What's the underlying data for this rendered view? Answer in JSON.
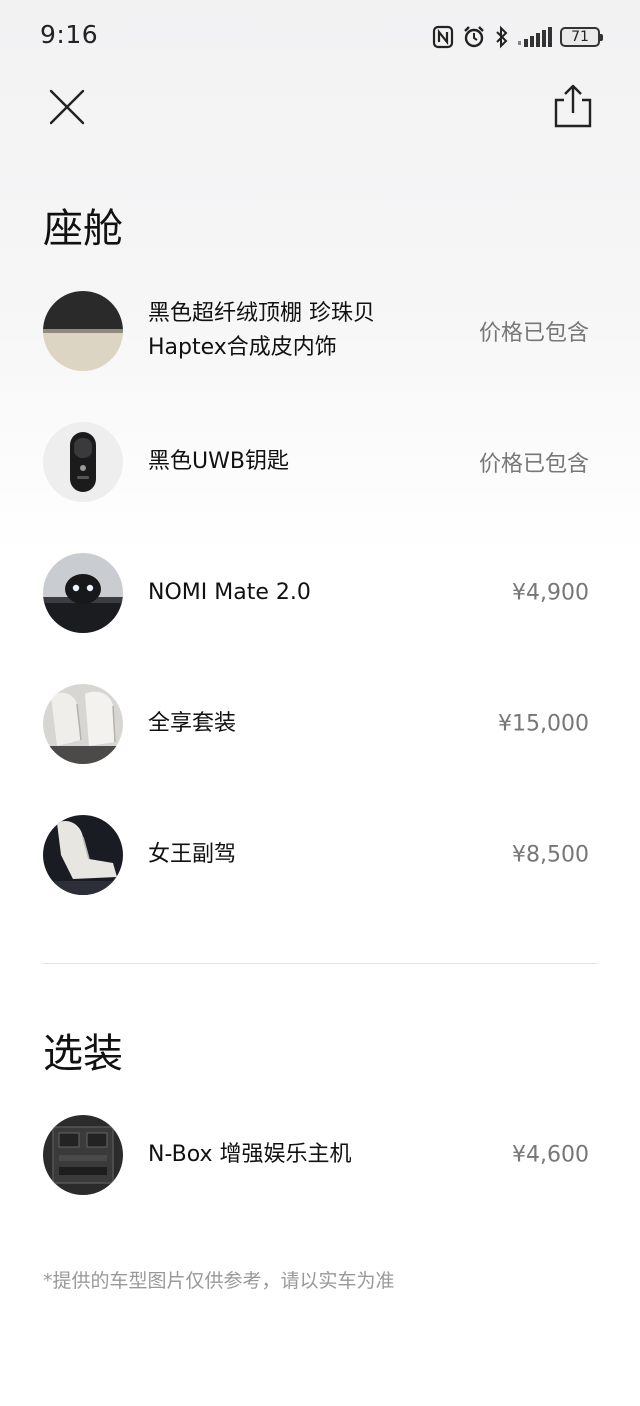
{
  "status_bar": {
    "time": "9:16",
    "battery": "71"
  },
  "header": {
    "close_icon": "close-icon",
    "share_icon": "share-icon"
  },
  "sections": {
    "cabin": {
      "title": "座舱",
      "items": [
        {
          "name": "黑色超纤绒顶棚 珍珠贝Haptex合成皮内饰",
          "price": "价格已包含"
        },
        {
          "name": "黑色UWB钥匙",
          "price": "价格已包含"
        },
        {
          "name": "NOMI Mate 2.0",
          "price": "¥4,900"
        },
        {
          "name": "全享套装",
          "price": "¥15,000"
        },
        {
          "name": "女王副驾",
          "price": "¥8,500"
        }
      ]
    },
    "options": {
      "title": "选装",
      "items": [
        {
          "name": "N-Box 增强娱乐主机",
          "price": "¥4,600"
        }
      ]
    }
  },
  "footnote": "*提供的车型图片仅供参考，请以实车为准"
}
